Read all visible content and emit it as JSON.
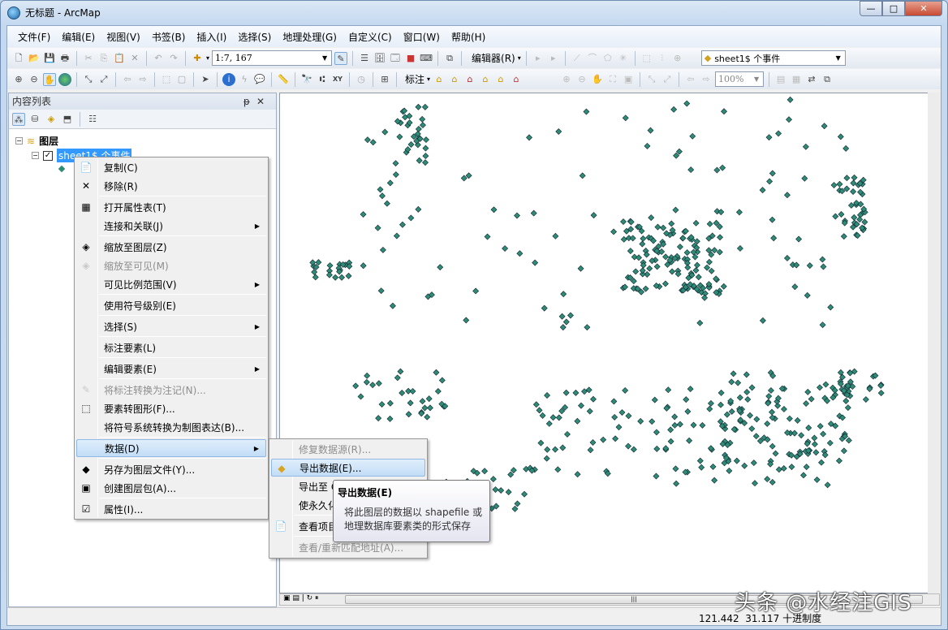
{
  "window": {
    "title": "无标题 - ArcMap",
    "controls": [
      "minimize",
      "maximize",
      "close"
    ]
  },
  "menubar": [
    "文件(F)",
    "编辑(E)",
    "视图(V)",
    "书签(B)",
    "插入(I)",
    "选择(S)",
    "地理处理(G)",
    "自定义(C)",
    "窗口(W)",
    "帮助(H)"
  ],
  "toolbar": {
    "scale": "1:7, 167",
    "editor": "编辑器(R)",
    "target_layer": "sheet1$ 个事件",
    "label": "标注",
    "zoom_pct": "100%"
  },
  "toc": {
    "title": "内容列表",
    "root": "图层",
    "layer": "sheet1$ 个事件"
  },
  "context_menu": {
    "items": [
      {
        "label": "复制(C)",
        "icon": "copy-icon"
      },
      {
        "label": "移除(R)",
        "icon": "remove-icon"
      },
      {
        "label": "打开属性表(T)",
        "icon": "table-icon"
      },
      {
        "label": "连接和关联(J)",
        "submenu": true
      },
      {
        "label": "缩放至图层(Z)",
        "icon": "zoom-layer-icon"
      },
      {
        "label": "缩放至可见(M)",
        "disabled": true,
        "icon": "zoom-visible-icon"
      },
      {
        "label": "可见比例范围(V)",
        "submenu": true
      },
      {
        "label": "使用符号级别(E)"
      },
      {
        "label": "选择(S)",
        "submenu": true
      },
      {
        "label": "标注要素(L)"
      },
      {
        "label": "编辑要素(E)",
        "submenu": true
      },
      {
        "label": "将标注转换为注记(N)...",
        "disabled": true,
        "icon": "annotation-icon"
      },
      {
        "label": "要素转图形(F)...",
        "icon": "graphics-icon"
      },
      {
        "label": "将符号系统转换为制图表达(B)..."
      },
      {
        "label": "数据(D)",
        "submenu": true,
        "highlighted": true
      },
      {
        "label": "另存为图层文件(Y)...",
        "icon": "layer-file-icon"
      },
      {
        "label": "创建图层包(A)...",
        "icon": "layer-package-icon"
      },
      {
        "label": "属性(I)...",
        "icon": "properties-icon"
      }
    ]
  },
  "data_submenu": {
    "items": [
      {
        "label": "修复数据源(R)...",
        "disabled": true
      },
      {
        "label": "导出数据(E)...",
        "highlighted": true
      },
      {
        "label": "导出至 CAD..."
      },
      {
        "label": "使永久化"
      },
      {
        "label": "查看项目描述"
      },
      {
        "label": "查看/重新匹配地址(A)...",
        "disabled": true
      }
    ]
  },
  "tooltip": {
    "title": "导出数据(E)",
    "body": "将此图层的数据以 shapefile 或地理数据库要素类的形式保存"
  },
  "status": {
    "x": "121.442",
    "y": "31.117",
    "units": "十进制度"
  },
  "watermark": "头条 @水经注GIS",
  "colors": {
    "point_fill": "#2e8b74",
    "highlight": "#c2ddf6",
    "selection": "#3399ff"
  }
}
